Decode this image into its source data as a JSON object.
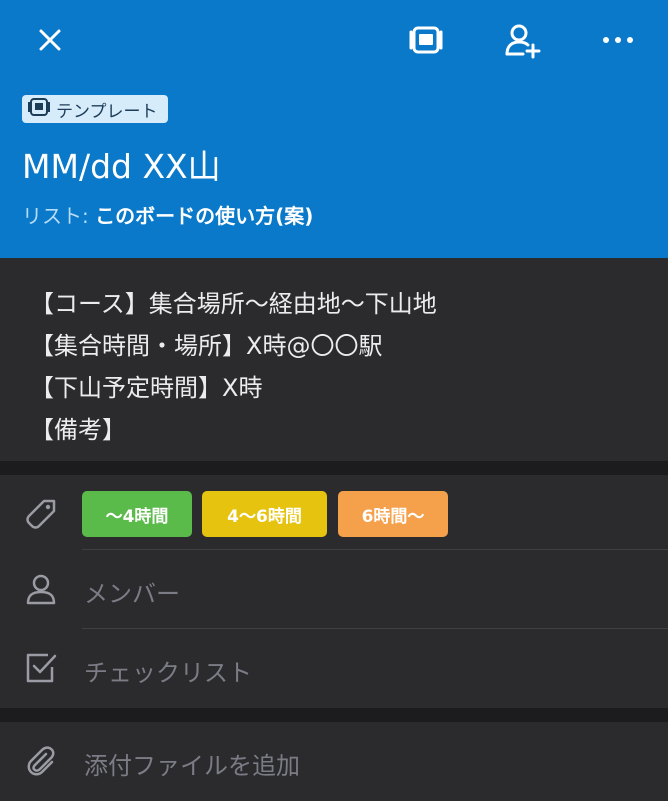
{
  "header": {
    "badge_label": "テンプレート",
    "title": "MM/dd XX山",
    "list_label": "リスト:",
    "list_name": "このボードの使い方(案)",
    "colors": {
      "background": "#0a79c9"
    }
  },
  "description": {
    "lines": [
      "【コース】集合場所〜経由地〜下山地",
      "【集合時間・場所】X時@〇〇駅",
      "【下山予定時間】X時",
      "【備考】"
    ]
  },
  "labels": [
    {
      "text": "〜4時間",
      "color": "#5aba4a"
    },
    {
      "text": "4〜6時間",
      "color": "#e5c30f"
    },
    {
      "text": "6時間〜",
      "color": "#f5a04a"
    }
  ],
  "rows": {
    "members_placeholder": "メンバー",
    "checklist_placeholder": "チェックリスト",
    "attachment_placeholder": "添付ファイルを追加"
  },
  "icons": [
    "close-icon",
    "card-template-icon",
    "add-member-icon",
    "more-icon",
    "tag-icon",
    "person-icon",
    "checkbox-icon",
    "paperclip-icon"
  ]
}
